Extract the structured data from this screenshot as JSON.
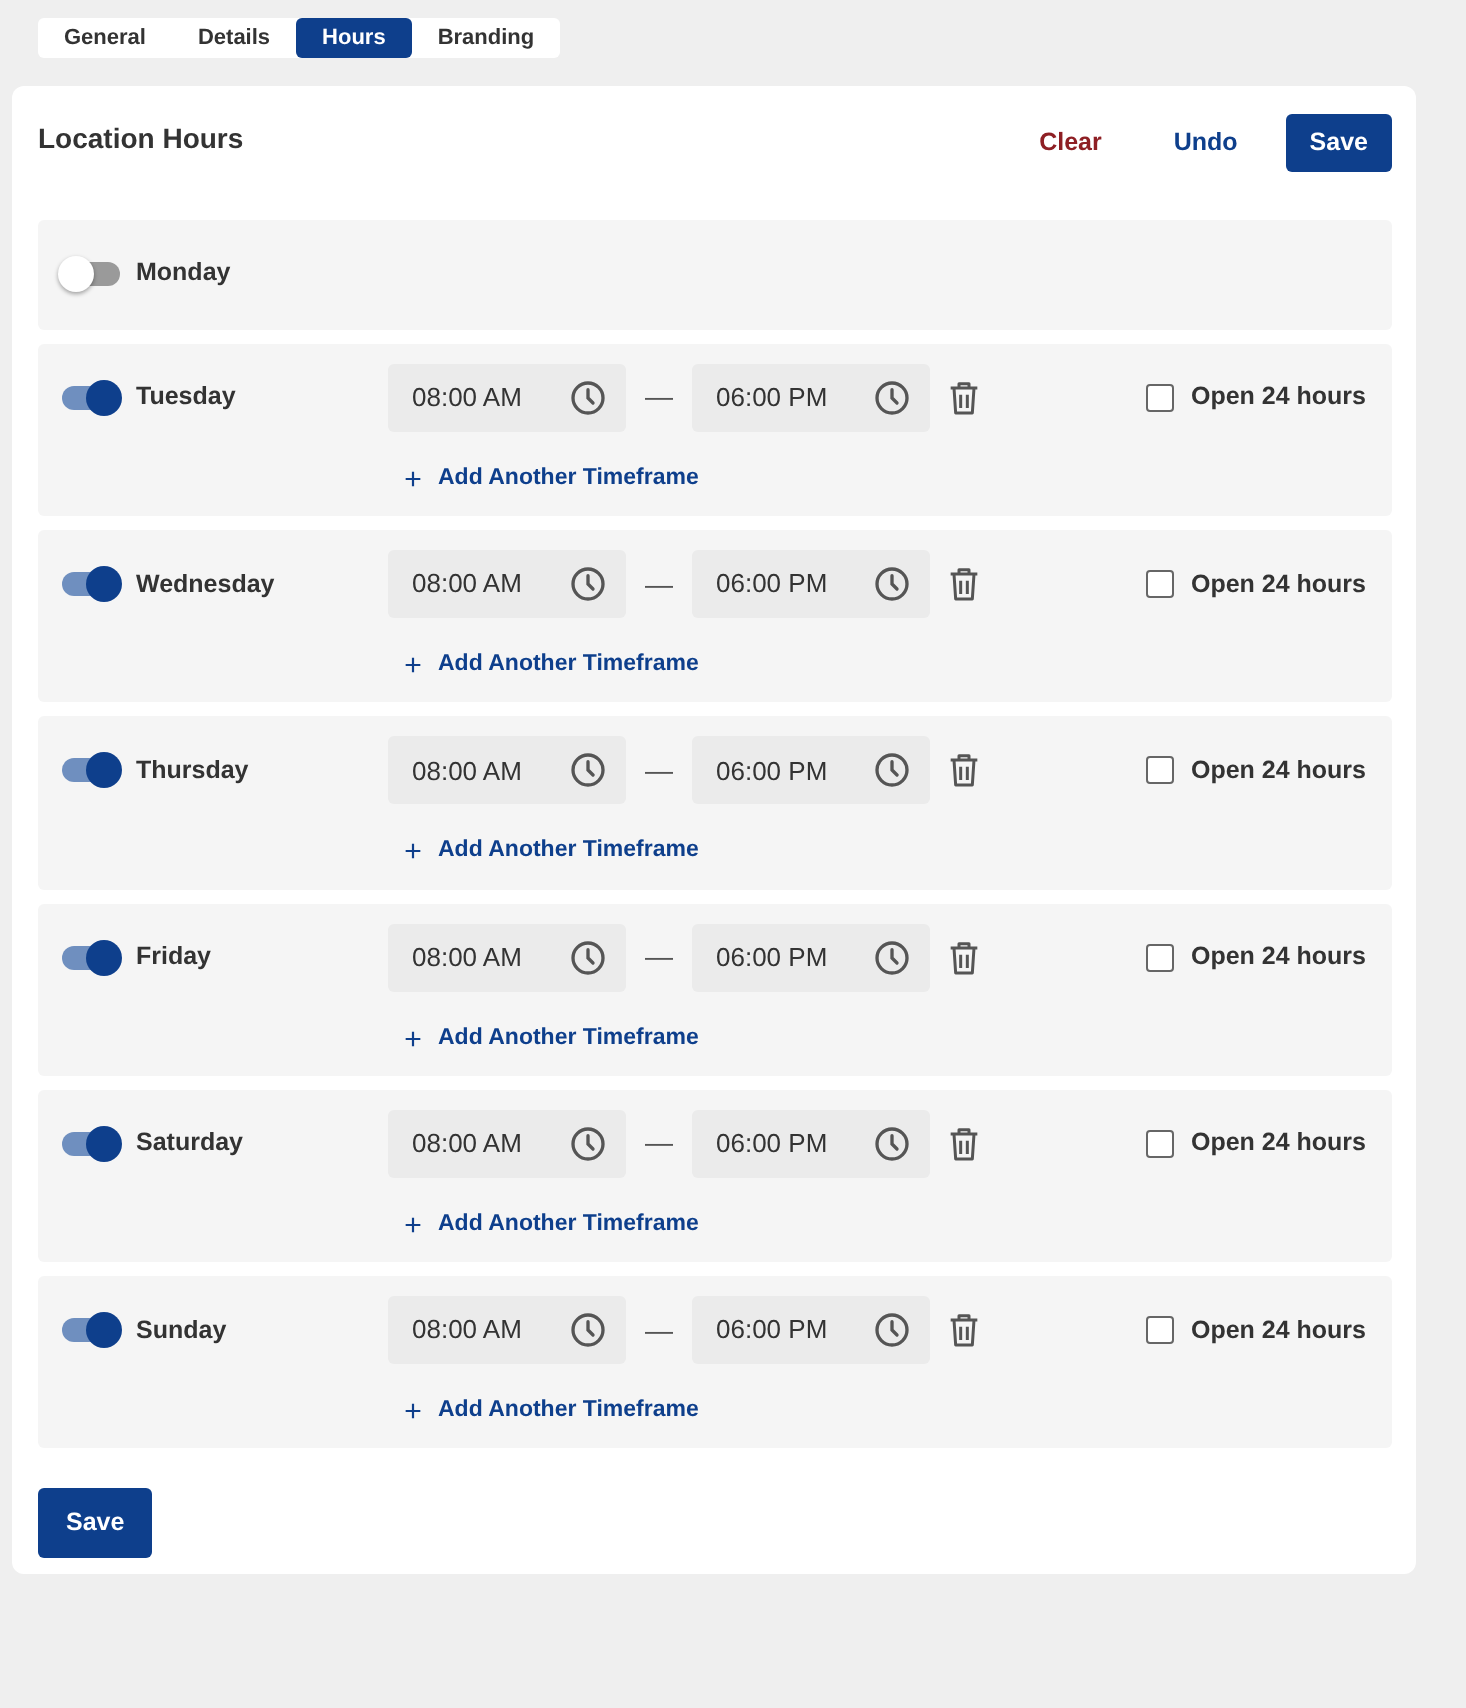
{
  "tabs": [
    {
      "label": "General",
      "selected": false
    },
    {
      "label": "Details",
      "selected": false
    },
    {
      "label": "Hours",
      "selected": true
    },
    {
      "label": "Branding",
      "selected": false
    }
  ],
  "panel": {
    "title": "Location Hours",
    "actions": [
      {
        "label": "Clear",
        "kind": "danger"
      },
      {
        "label": "Undo",
        "kind": "link"
      },
      {
        "label": "Save",
        "kind": "primary"
      }
    ],
    "days": [
      {
        "name": "Monday",
        "on": false
      },
      {
        "name": "Tuesday",
        "on": true,
        "timeframes": [
          {
            "start": "08:00 AM",
            "separator": "—",
            "end": "06:00 PM"
          }
        ],
        "add_label": "Add Another Timeframe",
        "open_24": {
          "label": "Open 24 hours",
          "checked": false
        }
      },
      {
        "name": "Wednesday",
        "on": true,
        "timeframes": [
          {
            "start": "08:00 AM",
            "separator": "—",
            "end": "06:00 PM"
          }
        ],
        "add_label": "Add Another Timeframe",
        "open_24": {
          "label": "Open 24 hours",
          "checked": false
        }
      },
      {
        "name": "Thursday",
        "on": true,
        "timeframes": [
          {
            "start": "08:00 AM",
            "separator": "—",
            "end": "06:00 PM"
          }
        ],
        "add_label": "Add Another Timeframe",
        "open_24": {
          "label": "Open 24 hours",
          "checked": false
        }
      },
      {
        "name": "Friday",
        "on": true,
        "timeframes": [
          {
            "start": "08:00 AM",
            "separator": "—",
            "end": "06:00 PM"
          }
        ],
        "add_label": "Add Another Timeframe",
        "open_24": {
          "label": "Open 24 hours",
          "checked": false
        }
      },
      {
        "name": "Saturday",
        "on": true,
        "timeframes": [
          {
            "start": "08:00 AM",
            "separator": "—",
            "end": "06:00 PM"
          }
        ],
        "add_label": "Add Another Timeframe",
        "open_24": {
          "label": "Open 24 hours",
          "checked": false
        }
      },
      {
        "name": "Sunday",
        "on": true,
        "timeframes": [
          {
            "start": "08:00 AM",
            "separator": "—",
            "end": "06:00 PM"
          }
        ],
        "add_label": "Add Another Timeframe",
        "open_24": {
          "label": "Open 24 hours",
          "checked": false
        }
      }
    ],
    "footer_button": {
      "label": "Save",
      "kind": "primary"
    }
  }
}
